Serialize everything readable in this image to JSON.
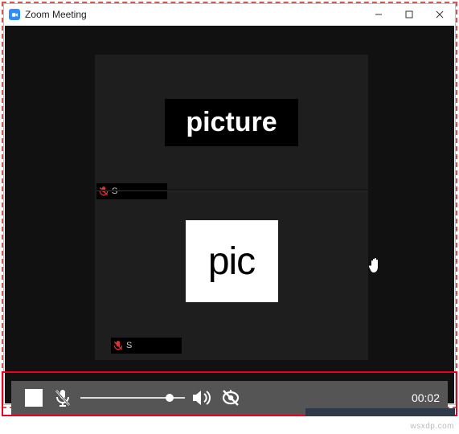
{
  "window": {
    "title": "Zoom Meeting"
  },
  "participants": {
    "upper": {
      "thumbnail_label": "picture",
      "name_initial": "S",
      "muted": true
    },
    "lower": {
      "thumbnail_label": "pic",
      "name_initial": "S",
      "muted": true,
      "hand_raised": true
    }
  },
  "recorder": {
    "timer": "00:02",
    "controls": {
      "stop": "Stop",
      "mute_mic": "Mute Microphone",
      "volume": "Volume",
      "speaker": "Speaker",
      "camera_off": "Camera Off"
    }
  },
  "watermark": "wsxdp.com",
  "colors": {
    "accent": "#2d8cff",
    "highlight": "#e02222"
  }
}
